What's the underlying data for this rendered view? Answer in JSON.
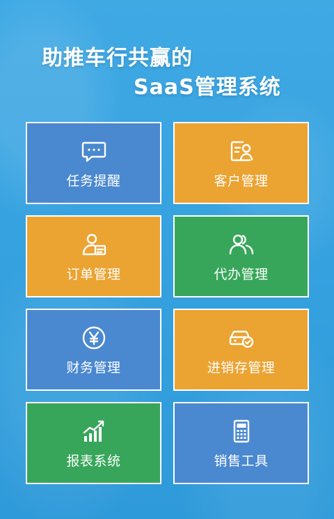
{
  "colors": {
    "blue": "#4a88d0",
    "orange": "#eba332",
    "green": "#37a65a",
    "background": "#36a2e0"
  },
  "headline": {
    "line1": "助推车行共赢的",
    "line2": "SaaS管理系统"
  },
  "tiles": [
    {
      "label": "任务提醒",
      "icon": "chat-bubble-icon",
      "color": "blue"
    },
    {
      "label": "客户管理",
      "icon": "customer-card-icon",
      "color": "orange"
    },
    {
      "label": "订单管理",
      "icon": "user-document-icon",
      "color": "orange"
    },
    {
      "label": "代办管理",
      "icon": "users-icon",
      "color": "green"
    },
    {
      "label": "财务管理",
      "icon": "yen-icon",
      "color": "blue"
    },
    {
      "label": "进销存管理",
      "icon": "car-check-icon",
      "color": "orange"
    },
    {
      "label": "报表系统",
      "icon": "bar-chart-icon",
      "color": "green"
    },
    {
      "label": "销售工具",
      "icon": "calculator-icon",
      "color": "blue"
    }
  ]
}
